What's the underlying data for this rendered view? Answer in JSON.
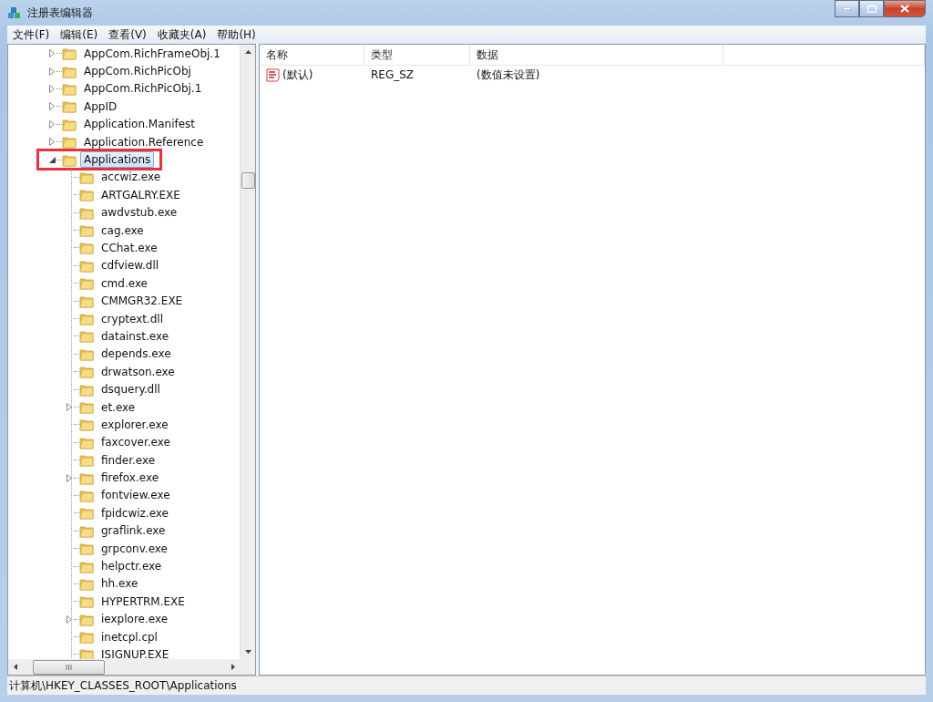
{
  "window": {
    "title": "注册表编辑器"
  },
  "menu": [
    "文件(F)",
    "编辑(E)",
    "查看(V)",
    "收藏夹(A)",
    "帮助(H)"
  ],
  "tree": [
    {
      "label": "AppCom.RichFrameObj.1",
      "expandable": true,
      "expanded": false,
      "selected": false,
      "annotated": false
    },
    {
      "label": "AppCom.RichPicObj",
      "expandable": true,
      "expanded": false,
      "selected": false,
      "annotated": false
    },
    {
      "label": "AppCom.RichPicObj.1",
      "expandable": true,
      "expanded": false,
      "selected": false,
      "annotated": false
    },
    {
      "label": "AppID",
      "expandable": true,
      "expanded": false,
      "selected": false,
      "annotated": false
    },
    {
      "label": "Application.Manifest",
      "expandable": true,
      "expanded": false,
      "selected": false,
      "annotated": false
    },
    {
      "label": "Application.Reference",
      "expandable": true,
      "expanded": false,
      "selected": false,
      "annotated": false
    },
    {
      "label": "Applications",
      "expandable": true,
      "expanded": true,
      "selected": true,
      "annotated": true,
      "children": [
        {
          "label": "accwiz.exe",
          "expandable": false,
          "selected": false,
          "annotated": false
        },
        {
          "label": "ARTGALRY.EXE",
          "expandable": false,
          "selected": false,
          "annotated": false
        },
        {
          "label": "awdvstub.exe",
          "expandable": false,
          "selected": false,
          "annotated": false
        },
        {
          "label": "cag.exe",
          "expandable": false,
          "selected": false,
          "annotated": false
        },
        {
          "label": "CChat.exe",
          "expandable": false,
          "selected": false,
          "annotated": false
        },
        {
          "label": "cdfview.dll",
          "expandable": false,
          "selected": false,
          "annotated": false
        },
        {
          "label": "cmd.exe",
          "expandable": false,
          "selected": false,
          "annotated": false
        },
        {
          "label": "CMMGR32.EXE",
          "expandable": false,
          "selected": false,
          "annotated": false
        },
        {
          "label": "cryptext.dll",
          "expandable": false,
          "selected": false,
          "annotated": false
        },
        {
          "label": "datainst.exe",
          "expandable": false,
          "selected": false,
          "annotated": false
        },
        {
          "label": "depends.exe",
          "expandable": false,
          "selected": false,
          "annotated": false
        },
        {
          "label": "drwatson.exe",
          "expandable": false,
          "selected": false,
          "annotated": false
        },
        {
          "label": "dsquery.dll",
          "expandable": false,
          "selected": false,
          "annotated": false
        },
        {
          "label": "et.exe",
          "expandable": true,
          "expanded": false,
          "selected": false,
          "annotated": false
        },
        {
          "label": "explorer.exe",
          "expandable": false,
          "selected": false,
          "annotated": false
        },
        {
          "label": "faxcover.exe",
          "expandable": false,
          "selected": false,
          "annotated": false
        },
        {
          "label": "finder.exe",
          "expandable": false,
          "selected": false,
          "annotated": false
        },
        {
          "label": "firefox.exe",
          "expandable": true,
          "expanded": false,
          "selected": false,
          "annotated": false
        },
        {
          "label": "fontview.exe",
          "expandable": false,
          "selected": false,
          "annotated": false
        },
        {
          "label": "fpidcwiz.exe",
          "expandable": false,
          "selected": false,
          "annotated": false
        },
        {
          "label": "graflink.exe",
          "expandable": false,
          "selected": false,
          "annotated": false
        },
        {
          "label": "grpconv.exe",
          "expandable": false,
          "selected": false,
          "annotated": false
        },
        {
          "label": "helpctr.exe",
          "expandable": false,
          "selected": false,
          "annotated": false
        },
        {
          "label": "hh.exe",
          "expandable": false,
          "selected": false,
          "annotated": false
        },
        {
          "label": "HYPERTRM.EXE",
          "expandable": false,
          "selected": false,
          "annotated": false
        },
        {
          "label": "iexplore.exe",
          "expandable": true,
          "expanded": false,
          "selected": false,
          "annotated": false
        },
        {
          "label": "inetcpl.cpl",
          "expandable": false,
          "selected": false,
          "annotated": false
        },
        {
          "label": "ISIGNUP.EXE",
          "expandable": false,
          "selected": false,
          "annotated": false
        }
      ]
    }
  ],
  "values": {
    "columns": [
      "名称",
      "类型",
      "数据"
    ],
    "rows": [
      {
        "name": "(默认)",
        "type": "REG_SZ",
        "data": "(数值未设置)"
      }
    ]
  },
  "status_bar": "计算机\\HKEY_CLASSES_ROOT\\Applications"
}
